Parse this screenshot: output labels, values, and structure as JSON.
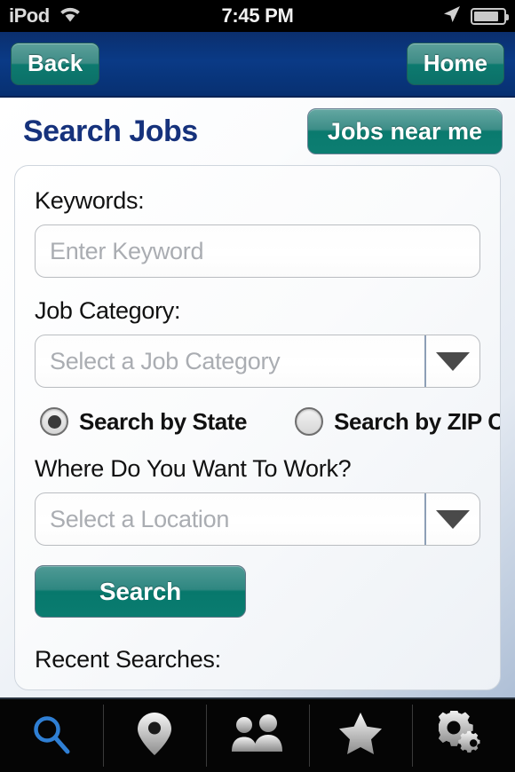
{
  "statusbar": {
    "carrier": "iPod",
    "time": "7:45 PM",
    "wifi_icon": "wifi-icon",
    "location_icon": "location-arrow-icon",
    "battery_icon": "battery-icon"
  },
  "navbar": {
    "back_label": "Back",
    "home_label": "Home"
  },
  "header": {
    "title": "Search Jobs",
    "jobs_near_me_label": "Jobs near me"
  },
  "form": {
    "keywords_label": "Keywords:",
    "keywords_placeholder": "Enter Keyword",
    "job_category_label": "Job Category:",
    "job_category_placeholder": "Select a Job Category",
    "radio_state_label": "Search by State",
    "radio_zip_label": "Search by ZIP Code",
    "radio_state_selected": true,
    "radio_zip_selected": false,
    "location_label": "Where Do You Want To Work?",
    "location_placeholder": "Select a Location",
    "search_button_label": "Search",
    "recent_searches_label": "Recent Searches:"
  },
  "tabbar": {
    "items": [
      {
        "name": "tab-search",
        "icon": "magnifier-icon",
        "active": true
      },
      {
        "name": "tab-locations",
        "icon": "map-pin-icon",
        "active": false
      },
      {
        "name": "tab-people",
        "icon": "people-icon",
        "active": false
      },
      {
        "name": "tab-favorites",
        "icon": "star-icon",
        "active": false
      },
      {
        "name": "tab-settings",
        "icon": "gears-icon",
        "active": false
      }
    ]
  },
  "colors": {
    "navbar_blue": "#0A3A86",
    "title_blue": "#16327C",
    "button_teal": "#0A7A6E",
    "active_tab_blue": "#2F7FD4"
  }
}
